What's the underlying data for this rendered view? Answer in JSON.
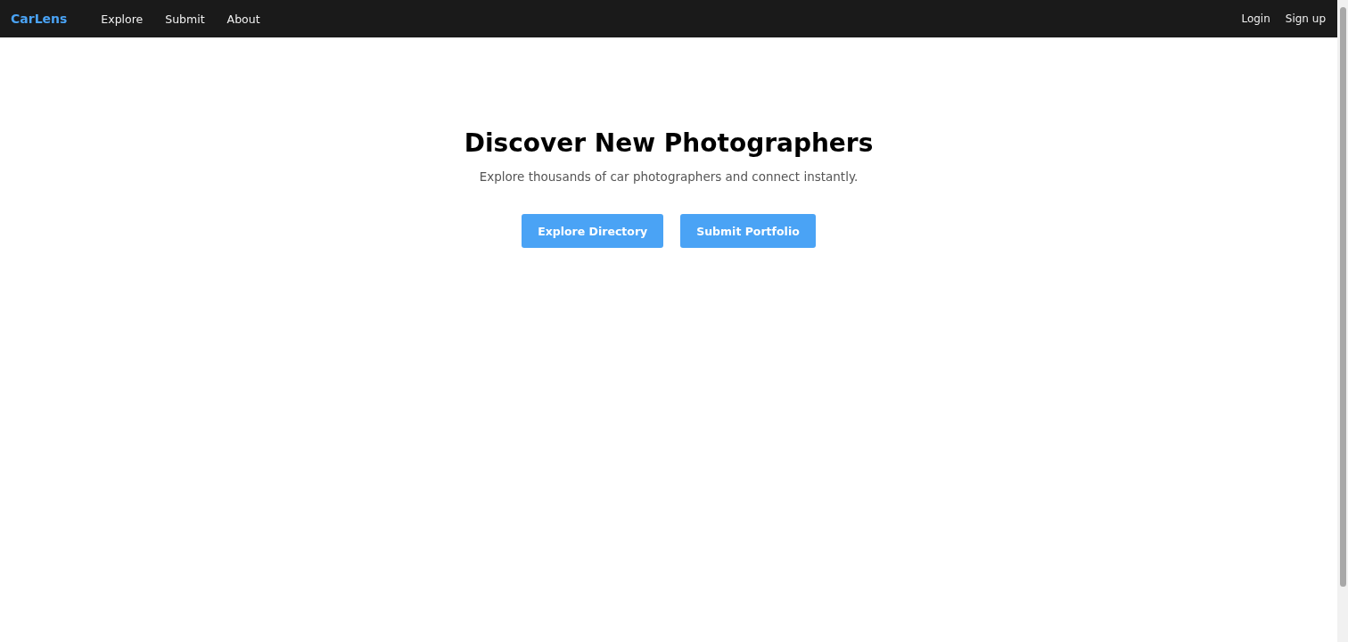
{
  "nav": {
    "brand": "CarLens",
    "links": [
      "Explore",
      "Submit",
      "About"
    ],
    "auth": [
      "Login",
      "Sign up"
    ]
  },
  "hero": {
    "title": "Discover New Photographers",
    "subtitle": "Explore thousands of car photographers and connect instantly.",
    "buttons": [
      "Explore Directory",
      "Submit Portfolio"
    ]
  }
}
